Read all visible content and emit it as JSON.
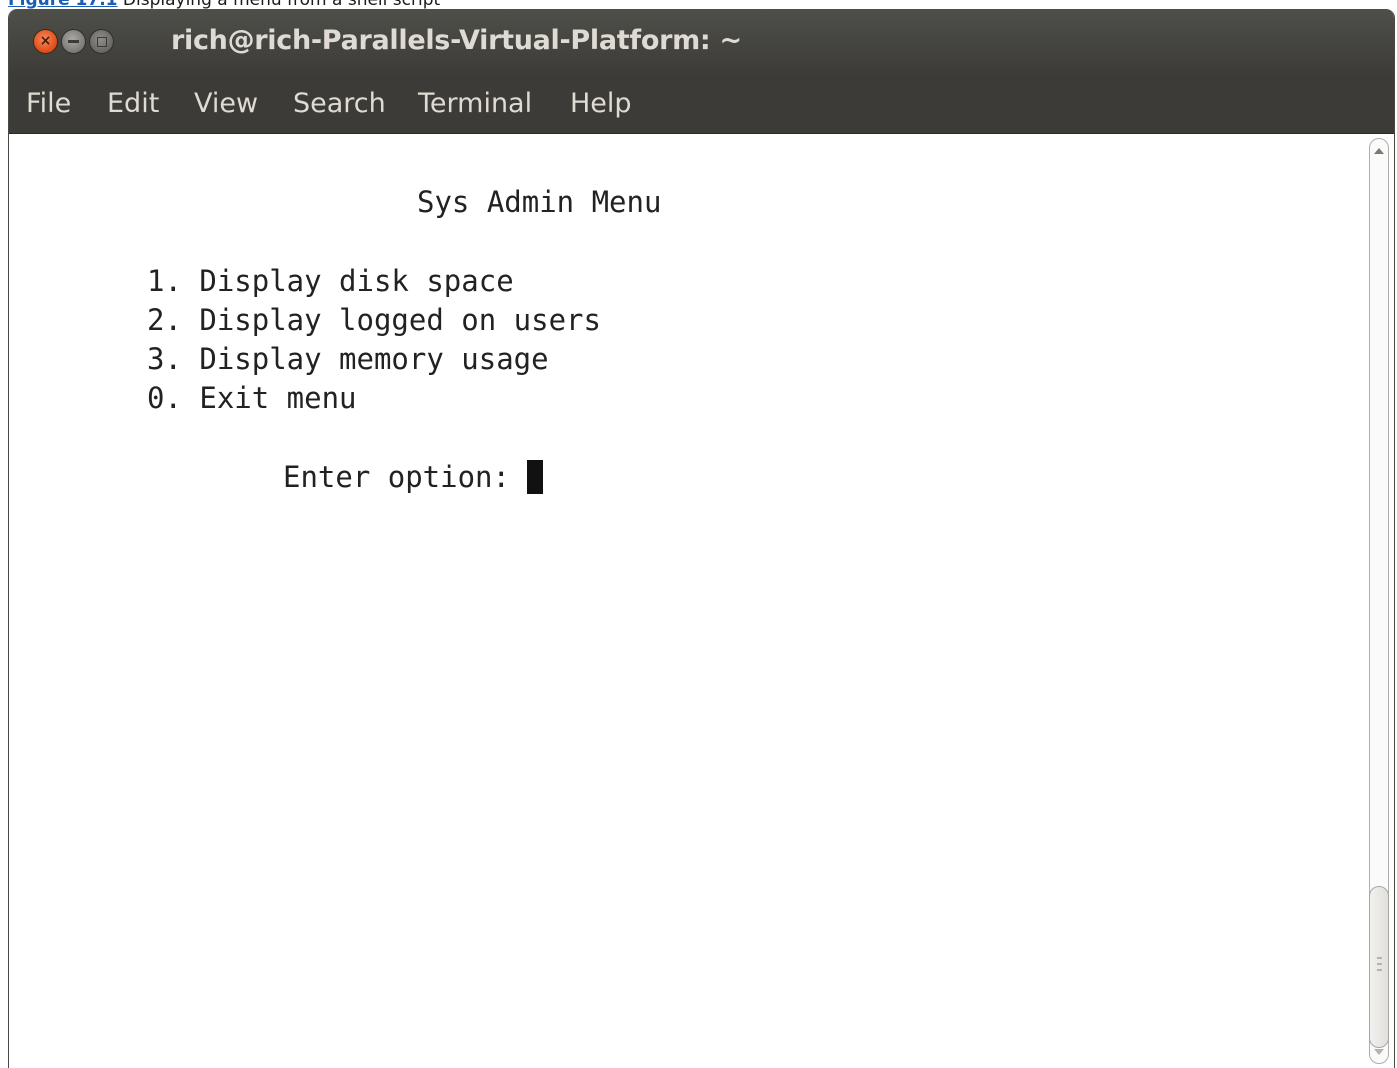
{
  "caption": {
    "figure_label": "Figure 17.1",
    "text": " Displaying a menu from a shell script"
  },
  "window": {
    "title": "rich@rich-Parallels-Virtual-Platform: ~",
    "close_glyph": "×"
  },
  "menubar": {
    "items": [
      "File",
      "Edit",
      "View",
      "Search",
      "Terminal",
      "Help"
    ]
  },
  "terminal": {
    "heading": "Sys Admin Menu",
    "options": [
      "1. Display disk space",
      "2. Display logged on users",
      "3. Display memory usage",
      "0. Exit menu"
    ],
    "prompt": "Enter option: "
  },
  "icons": {
    "close": "close-icon",
    "minimize": "minimize-icon",
    "maximize": "maximize-icon",
    "scroll_up": "chevron-up-icon",
    "scroll_down": "chevron-down-icon",
    "grip": "scroll-grip-icon"
  },
  "colors": {
    "titlebar": "#3c3b37",
    "menu_text": "#dfdbd2",
    "close_button": "#df4a16",
    "terminal_bg": "#ffffff",
    "terminal_text": "#222222"
  },
  "scrollbar": {
    "position": 1.0
  }
}
